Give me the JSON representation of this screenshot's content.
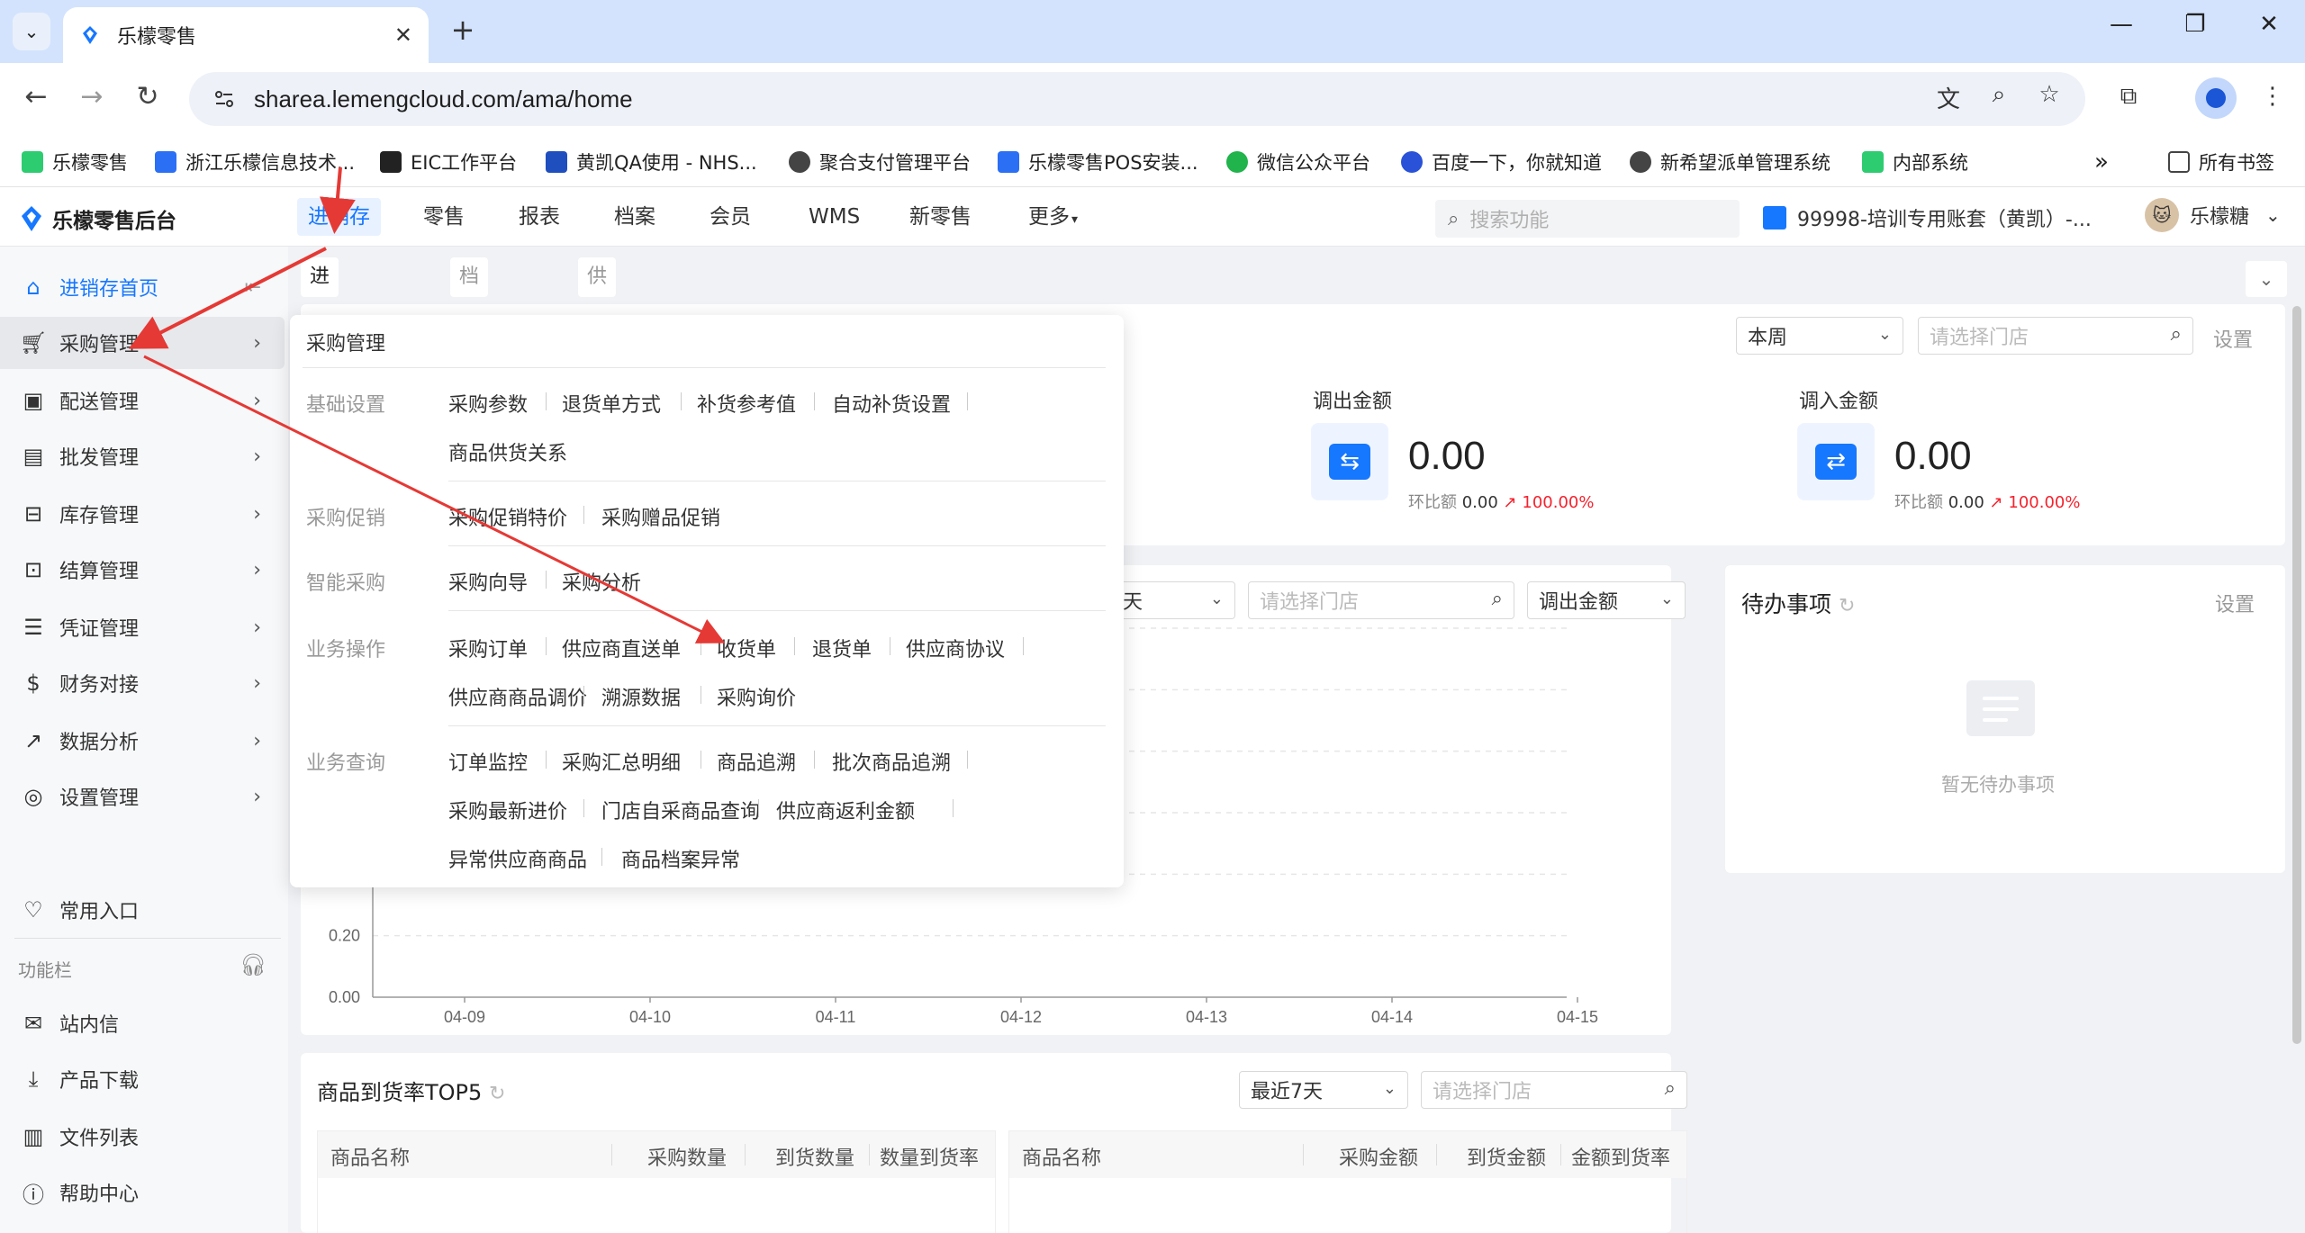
{
  "browser": {
    "tab_title": "乐檬零售",
    "url": "sharea.lemengcloud.com/ama/home",
    "bookmarks": [
      {
        "label": "乐檬零售",
        "color": "#2ecc71"
      },
      {
        "label": "浙江乐檬信息技术...",
        "color": "#2b6ff5"
      },
      {
        "label": "EIC工作平台",
        "color": "#222222"
      },
      {
        "label": "黄凯QA使用 - NHS...",
        "color": "#1f4fbf"
      },
      {
        "label": "聚合支付管理平台",
        "color": "#444444"
      },
      {
        "label": "乐檬零售POS安装...",
        "color": "#2b6ff5"
      },
      {
        "label": "微信公众平台",
        "color": "#21b34c"
      },
      {
        "label": "百度一下，你就知道",
        "color": "#2a52d8"
      },
      {
        "label": "新希望派单管理系统",
        "color": "#444444"
      },
      {
        "label": "内部系统",
        "color": "#2ecc71"
      }
    ],
    "all_bookmarks": "所有书签",
    "more_bookmarks": "»"
  },
  "app": {
    "logo_text": "乐檬零售后台",
    "topnav": [
      "进销存",
      "零售",
      "报表",
      "档案",
      "会员",
      "WMS",
      "新零售",
      "更多"
    ],
    "search_placeholder": "搜索功能",
    "account": "99998-培训专用账套（黄凯）-...",
    "user": "乐檬糖"
  },
  "sidebar": {
    "items": [
      {
        "label": "进销存首页",
        "icon": "home-icon"
      },
      {
        "label": "采购管理",
        "icon": "cart-icon"
      },
      {
        "label": "配送管理",
        "icon": "truck-icon"
      },
      {
        "label": "批发管理",
        "icon": "wallet-icon"
      },
      {
        "label": "库存管理",
        "icon": "box-icon"
      },
      {
        "label": "结算管理",
        "icon": "dollar-icon"
      },
      {
        "label": "凭证管理",
        "icon": "document-icon"
      },
      {
        "label": "财务对接",
        "icon": "finance-icon"
      },
      {
        "label": "数据分析",
        "icon": "chart-icon"
      },
      {
        "label": "设置管理",
        "icon": "settings-icon"
      }
    ],
    "common": "常用入口",
    "function_bar": "功能栏",
    "tools": [
      {
        "label": "站内信",
        "icon": "mail-icon"
      },
      {
        "label": "产品下载",
        "icon": "download-icon"
      },
      {
        "label": "文件列表",
        "icon": "file-list-icon"
      },
      {
        "label": "帮助中心",
        "icon": "help-icon"
      }
    ]
  },
  "tabs": [
    "进销存首页",
    "档案首页",
    "供应商管理"
  ],
  "overview": {
    "period": "本周",
    "store_placeholder": "请选择门店",
    "settings": "设置",
    "stats": [
      {
        "label": "调出金额",
        "value": "0.00",
        "ratio_label": "环比额",
        "ratio_value": "0.00",
        "pct": "100.00%"
      },
      {
        "label": "调入金额",
        "value": "0.00",
        "ratio_label": "环比额",
        "ratio_value": "0.00",
        "pct": "100.00%"
      }
    ]
  },
  "trend": {
    "period_partial": "天",
    "store_placeholder": "请选择门店",
    "metric": "调出金额"
  },
  "chart_data": {
    "type": "line",
    "x": [
      "04-09",
      "04-10",
      "04-11",
      "04-12",
      "04-13",
      "04-14",
      "04-15"
    ],
    "y_ticks_visible": [
      "0.20",
      "0.00"
    ],
    "series": [],
    "ylim": [
      0,
      1
    ]
  },
  "todo": {
    "title": "待办事项",
    "settings": "设置",
    "empty": "暂无待办事项"
  },
  "top5": {
    "title": "商品到货率TOP5",
    "period": "最近7天",
    "store_placeholder": "请选择门店",
    "left_headers": [
      "商品名称",
      "采购数量",
      "到货数量",
      "数量到货率"
    ],
    "right_headers": [
      "商品名称",
      "采购金额",
      "到货金额",
      "金额到货率"
    ]
  },
  "menu": {
    "title": "采购管理",
    "groups": [
      {
        "category": "基础设置",
        "rows": [
          [
            "采购参数",
            "退货单方式",
            "补货参考值",
            "自动补货设置"
          ],
          [
            "商品供货关系"
          ]
        ]
      },
      {
        "category": "采购促销",
        "rows": [
          [
            "采购促销特价",
            "采购赠品促销"
          ]
        ]
      },
      {
        "category": "智能采购",
        "rows": [
          [
            "采购向导",
            "采购分析"
          ]
        ]
      },
      {
        "category": "业务操作",
        "rows": [
          [
            "采购订单",
            "供应商直送单",
            "收货单",
            "退货单",
            "供应商协议"
          ],
          [
            "供应商商品调价",
            "溯源数据",
            "采购询价"
          ]
        ]
      },
      {
        "category": "业务查询",
        "rows": [
          [
            "订单监控",
            "采购汇总明细",
            "商品追溯",
            "批次商品追溯"
          ],
          [
            "采购最新进价",
            "门店自采商品查询",
            "供应商返利金额"
          ],
          [
            "异常供应商商品",
            "商品档案异常"
          ]
        ]
      }
    ]
  },
  "colors": {
    "accent": "#1677ff",
    "annotation_arrow": "#e53935"
  }
}
